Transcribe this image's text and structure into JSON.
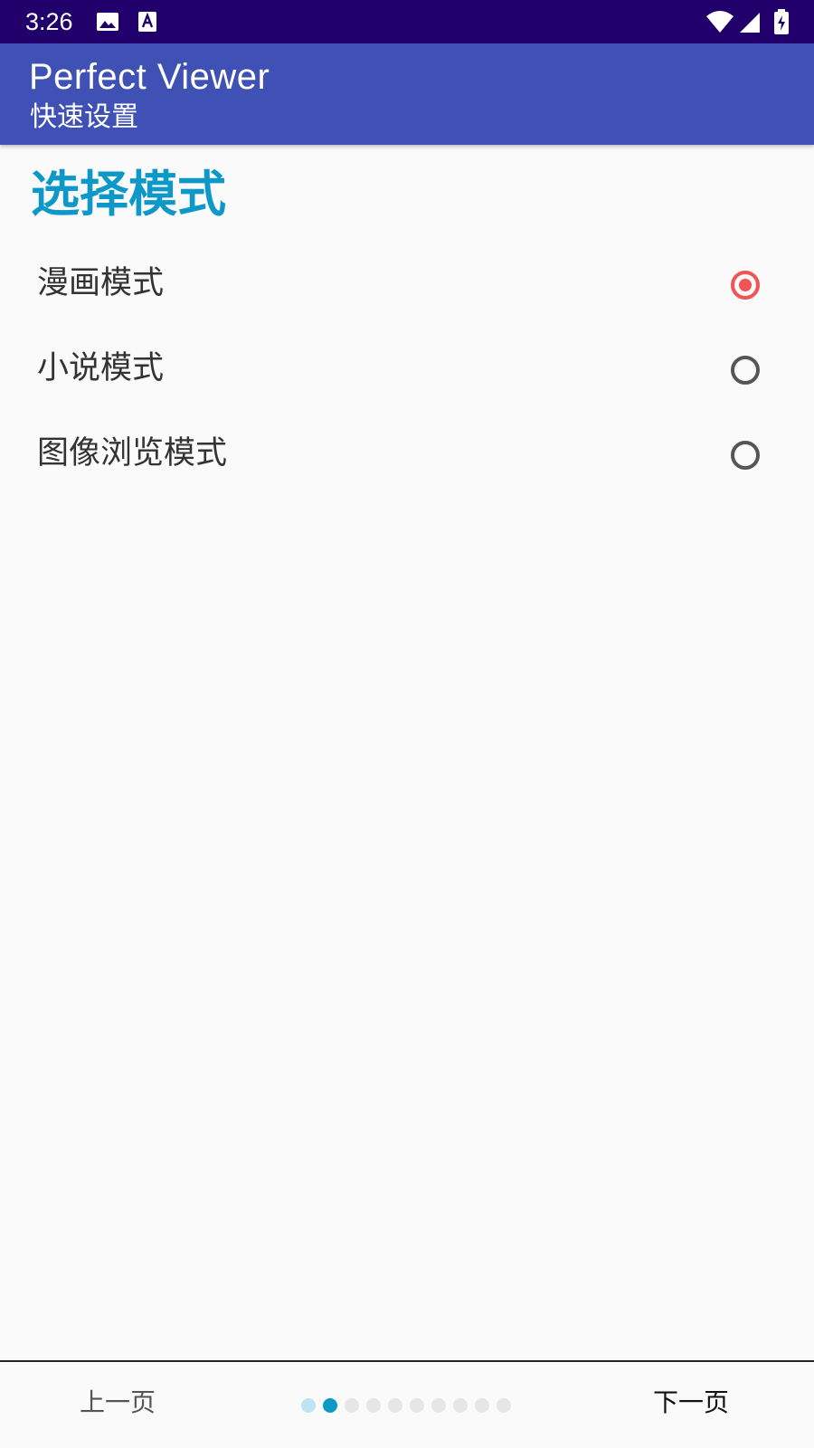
{
  "status_bar": {
    "time": "3:26",
    "icons": [
      "image-icon",
      "a-notification-icon",
      "wifi-icon",
      "signal-icon",
      "battery-charging-icon"
    ]
  },
  "app_bar": {
    "title": "Perfect Viewer",
    "subtitle": "快速设置"
  },
  "content": {
    "heading": "选择模式",
    "options": [
      {
        "label": "漫画模式",
        "selected": true
      },
      {
        "label": "小说模式",
        "selected": false
      },
      {
        "label": "图像浏览模式",
        "selected": false
      }
    ]
  },
  "bottom_nav": {
    "prev_label": "上一页",
    "next_label": "下一页",
    "page_indicator": {
      "total": 10,
      "current": 2
    }
  },
  "colors": {
    "status_bar": "#21006b",
    "app_bar": "#3f51b5",
    "accent": "#0d98c8",
    "radio_selected": "#f05454"
  }
}
